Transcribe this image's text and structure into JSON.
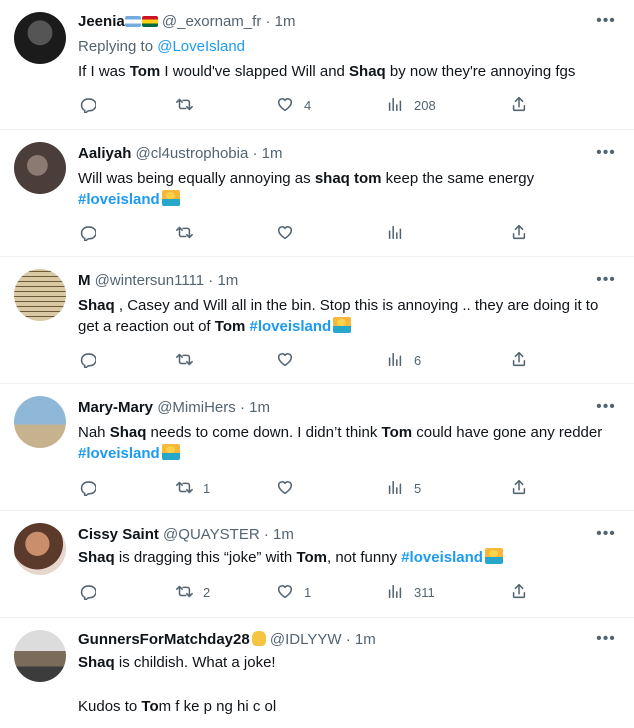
{
  "tweets": [
    {
      "name": "Jeenia",
      "handle": "@_exornam_fr",
      "sep": "·",
      "time": "1m",
      "reply_prefix": "Replying to ",
      "reply_link": "@LoveIsland",
      "segments": [
        {
          "t": "If I was "
        },
        {
          "t": "Tom",
          "b": true
        },
        {
          "t": " I would've slapped Will and "
        },
        {
          "t": "Shaq",
          "b": true
        },
        {
          "t": " by now they're annoying fgs"
        }
      ],
      "counts": {
        "reply": "",
        "retweet": "",
        "like": "4",
        "views": "208"
      },
      "avatar_colors": [
        "#1b1b1b",
        "#3a3a3a"
      ]
    },
    {
      "name": "Aaliyah",
      "handle": "@cl4ustrophobia",
      "sep": "·",
      "time": "1m",
      "segments": [
        {
          "t": "Will was being equally annoying as "
        },
        {
          "t": "shaq tom",
          "b": true
        },
        {
          "t": " keep the same energy "
        },
        {
          "br": true
        },
        {
          "t": "#loveisland",
          "tag": true
        },
        {
          "emoji": true
        }
      ],
      "counts": {
        "reply": "",
        "retweet": "",
        "like": "",
        "views": ""
      },
      "avatar_colors": [
        "#4a3d3a",
        "#8a7a72"
      ]
    },
    {
      "name": "M",
      "handle": "@wintersun1111",
      "sep": "·",
      "time": "1m",
      "segments": [
        {
          "t": "Shaq",
          "b": true
        },
        {
          "t": " , Casey and Will all in the bin. Stop this is annoying .. they are doing it to get a reaction out of "
        },
        {
          "t": "Tom",
          "b": true
        },
        {
          "t": " "
        },
        {
          "t": "#loveisland",
          "tag": true
        },
        {
          "emoji": true
        }
      ],
      "counts": {
        "reply": "",
        "retweet": "",
        "like": "",
        "views": "6"
      },
      "avatar_colors": [
        "#d9c9a2",
        "#5a4a30"
      ]
    },
    {
      "name": "Mary-Mary",
      "handle": "@MimiHers",
      "sep": "·",
      "time": "1m",
      "segments": [
        {
          "t": "Nah "
        },
        {
          "t": "Shaq",
          "b": true
        },
        {
          "t": " needs to come down. I didn’t think "
        },
        {
          "t": "Tom",
          "b": true
        },
        {
          "t": " could have gone any redder "
        },
        {
          "t": "#loveisland",
          "tag": true
        },
        {
          "emoji": true
        }
      ],
      "counts": {
        "reply": "",
        "retweet": "1",
        "like": "",
        "views": "5"
      },
      "avatar_colors": [
        "#8fb8d8",
        "#c7b28f"
      ]
    },
    {
      "name": "Cissy Saint",
      "handle": "@QUAYSTER",
      "sep": "·",
      "time": "1m",
      "segments": [
        {
          "t": "Shaq",
          "b": true
        },
        {
          "t": " is dragging this “joke” with "
        },
        {
          "t": "Tom",
          "b": true
        },
        {
          "t": ", not funny "
        },
        {
          "t": "#loveisland",
          "tag": true
        },
        {
          "emoji": true
        }
      ],
      "counts": {
        "reply": "",
        "retweet": "2",
        "like": "1",
        "views": "311"
      },
      "avatar_colors": [
        "#c98f6d",
        "#5b3a2c"
      ]
    },
    {
      "name": "GunnersForMatchday28",
      "handle": "@IDLYYW",
      "sep": "·",
      "time": "1m",
      "segments": [
        {
          "t": "Shaq",
          "b": true
        },
        {
          "t": " is childish. What a joke!"
        }
      ],
      "segments2": [
        {
          "t": "Kudos to "
        },
        {
          "t": "To",
          "b": true
        },
        {
          "t": "m f   ke  p ng hi   c  ol"
        }
      ],
      "counts": {
        "reply": "",
        "retweet": "",
        "like": "",
        "views": ""
      },
      "avatar_colors": [
        "#7a6b5a",
        "#3c3c3c"
      ]
    }
  ]
}
